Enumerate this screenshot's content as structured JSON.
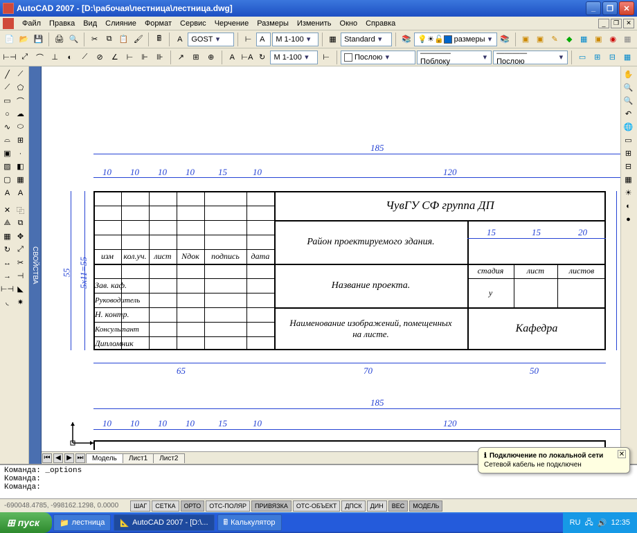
{
  "title": "AutoCAD 2007 - [D:\\рабочая\\лестница\\лестница.dwg]",
  "menu": [
    "Файл",
    "Правка",
    "Вид",
    "Слияние",
    "Формат",
    "Сервис",
    "Черчение",
    "Размеры",
    "Изменить",
    "Окно",
    "Справка"
  ],
  "tb1": {
    "font": "GOST",
    "letter": "А",
    "scale": "М 1-100",
    "style": "Standard",
    "layer": "размеры"
  },
  "tb2": {
    "scale": "М 1-100",
    "color": "Послою",
    "ltype": "———— Поблоку",
    "lw": "———— Послою"
  },
  "tabs": {
    "model": "Модель",
    "l1": "Лист1",
    "l2": "Лист2"
  },
  "cmd": {
    "l1": "Команда: _options",
    "l2": "Команда:",
    "l3": "Команда:"
  },
  "coord": "-690048.4785, -998162.1298, 0.0000",
  "status": [
    "ШАГ",
    "СЕТКА",
    "ОРТО",
    "ОТС-ПОЛЯР",
    "ПРИВЯЗКА",
    "ОТС-ОБЪЕКТ",
    "ДПСК",
    "ДИН",
    "ВЕС",
    "МОДЕЛЬ"
  ],
  "lang": "RU",
  "balloon": {
    "title": "Подключение по локальной сети",
    "msg": "Сетевой кабель не подключен"
  },
  "start": "пуск",
  "tasks": [
    "лестница",
    "AutoCAD 2007 - [D:\\...",
    "Калькулятор"
  ],
  "clock": "12:35",
  "prop": "СВОЙСТВА",
  "dims": {
    "w185": "185",
    "d10": "10",
    "d15": "15",
    "d20": "20",
    "d120": "120",
    "d65": "65",
    "d70": "70",
    "d50": "50",
    "v55": "55",
    "v5x11": "5х11=55"
  },
  "drw": {
    "title": "ЧувГУ СФ группа ДП",
    "r2": "Район проектируемого здания.",
    "r3": "Название проекта.",
    "r4a": "Наименование изображений, помещенных",
    "r4b": "на листе.",
    "stadia": "стадия",
    "list": "лист",
    "listov": "листов",
    "y": "у",
    "kaf": "Кафедра",
    "h1": "изм",
    "h2": "кол.уч.",
    "h3": "лист",
    "h4": "Nдок",
    "h5": "подпись",
    "h6": "дата",
    "row1": "Зав. каф.",
    "row2": "Руководитель",
    "row3": "Н. контр.",
    "row4": "Консультант",
    "row5": "Дипломник"
  }
}
